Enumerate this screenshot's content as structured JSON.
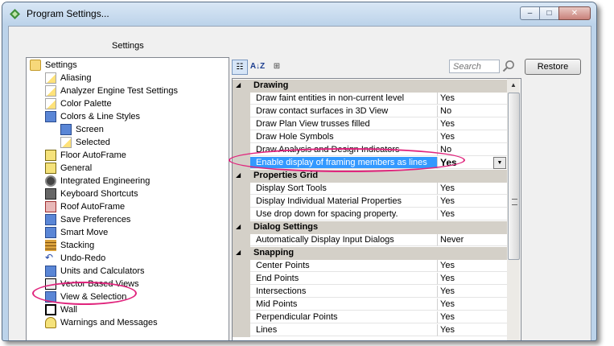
{
  "window": {
    "title": "Program Settings...",
    "min_label": "–",
    "max_label": "□",
    "close_label": "✕"
  },
  "left_panel": {
    "header": "Settings",
    "tree": [
      {
        "label": "Settings",
        "icon": "folder-icon"
      },
      {
        "label": "Aliasing",
        "icon": "page-icon"
      },
      {
        "label": "Analyzer Engine Test Settings",
        "icon": "page-icon"
      },
      {
        "label": "Color Palette",
        "icon": "page-icon"
      },
      {
        "label": "Colors & Line Styles",
        "icon": "palette-icon"
      },
      {
        "label": "Screen",
        "icon": "screen-icon"
      },
      {
        "label": "Selected",
        "icon": "cursor-icon"
      },
      {
        "label": "Floor AutoFrame",
        "icon": "floor-icon"
      },
      {
        "label": "General",
        "icon": "general-icon"
      },
      {
        "label": "Integrated Engineering",
        "icon": "gear-icon"
      },
      {
        "label": "Keyboard Shortcuts",
        "icon": "keyboard-icon"
      },
      {
        "label": "Roof AutoFrame",
        "icon": "roof-icon"
      },
      {
        "label": "Save Preferences",
        "icon": "save-icon"
      },
      {
        "label": "Smart Move",
        "icon": "move-icon"
      },
      {
        "label": "Stacking",
        "icon": "stacking-icon"
      },
      {
        "label": "Undo-Redo",
        "icon": "undo-icon"
      },
      {
        "label": "Units and Calculators",
        "icon": "calculator-icon"
      },
      {
        "label": "Vector Based Views",
        "icon": "vector-icon"
      },
      {
        "label": "View & Selection",
        "icon": "view-icon"
      },
      {
        "label": "Wall",
        "icon": "wall-icon"
      },
      {
        "label": "Warnings and Messages",
        "icon": "warning-icon"
      }
    ]
  },
  "toolbar": {
    "categorized_icon": "categorized-icon",
    "alphabetical_icon": "sort-az-icon",
    "alphabetical_label": "A↓Z",
    "property_pages_icon": "property-pages-icon",
    "search_placeholder": "Search",
    "restore_label": "Restore"
  },
  "grid": {
    "categories": [
      {
        "name": "Drawing",
        "toggle": "◢",
        "rows": [
          {
            "name": "Draw faint entities in non-current level",
            "value": "Yes"
          },
          {
            "name": "Draw contact surfaces in 3D View",
            "value": "No"
          },
          {
            "name": "Draw Plan View trusses filled",
            "value": "Yes"
          },
          {
            "name": "Draw Hole Symbols",
            "value": "Yes"
          },
          {
            "name": "Draw Analysis and Design Indicators",
            "value": "No"
          },
          {
            "name": "Enable display of framing members as lines",
            "value": "Yes",
            "selected": true
          }
        ]
      },
      {
        "name": "Properties Grid",
        "toggle": "◢",
        "rows": [
          {
            "name": "Display Sort Tools",
            "value": "Yes"
          },
          {
            "name": "Display Individual Material Properties",
            "value": "Yes"
          },
          {
            "name": "Use drop down for spacing property.",
            "value": "Yes"
          }
        ]
      },
      {
        "name": "Dialog Settings",
        "toggle": "◢",
        "rows": [
          {
            "name": "Automatically Display Input Dialogs",
            "value": "Never"
          }
        ]
      },
      {
        "name": "Snapping",
        "toggle": "◢",
        "rows": [
          {
            "name": "Center Points",
            "value": "Yes"
          },
          {
            "name": "End Points",
            "value": "Yes"
          },
          {
            "name": "Intersections",
            "value": "Yes"
          },
          {
            "name": "Mid Points",
            "value": "Yes"
          },
          {
            "name": "Perpendicular Points",
            "value": "Yes"
          },
          {
            "name": "Lines",
            "value": "Yes"
          }
        ]
      }
    ],
    "dropdown_glyph": "▼",
    "scroll_up_glyph": "▲"
  },
  "colors": {
    "selection": "#3399ff",
    "category_bg": "#d4d0c8",
    "annotation": "#e0257d"
  }
}
